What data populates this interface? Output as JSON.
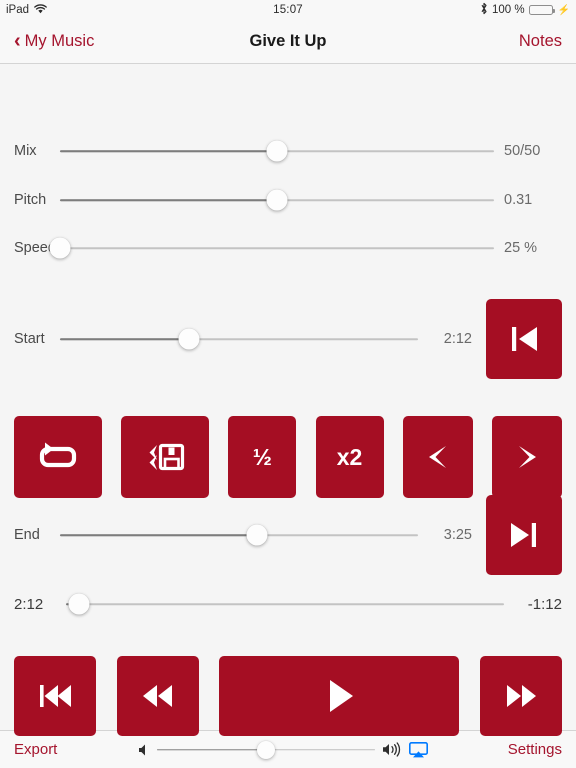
{
  "status_bar": {
    "device": "iPad",
    "wifi_icon": "wifi-icon",
    "time": "15:07",
    "bluetooth_icon": "bluetooth-icon",
    "battery_percent": "100 %",
    "battery_level": 100,
    "charging_icon": "lightning-bolt-icon"
  },
  "nav_bar": {
    "back_label": "My Music",
    "back_icon": "chevron-left-icon",
    "title": "Give It Up",
    "right_label": "Notes"
  },
  "sliders": {
    "mix": {
      "label": "Mix",
      "value": "50/50",
      "percent": 50
    },
    "pitch": {
      "label": "Pitch",
      "value": "0.31",
      "percent": 50
    },
    "speed": {
      "label": "Speed",
      "value": "25 %",
      "percent": 0
    },
    "start": {
      "label": "Start",
      "value": "2:12",
      "percent": 36
    },
    "end": {
      "label": "End",
      "value": "3:25",
      "percent": 55
    }
  },
  "jump_buttons": {
    "to_start": {
      "name": "skip-to-start-button",
      "icon": "skip-to-start-icon"
    },
    "to_end": {
      "name": "skip-to-end-button",
      "icon": "skip-to-end-icon"
    }
  },
  "loop_controls": [
    {
      "name": "loop-button",
      "icon": "loop-repeat-icon",
      "text": ""
    },
    {
      "name": "save-loop-button",
      "icon": "save-loop-icon",
      "text": ""
    },
    {
      "name": "half-speed-button",
      "icon": "",
      "text": "½"
    },
    {
      "name": "double-speed-button",
      "icon": "",
      "text": "x2"
    },
    {
      "name": "nudge-left-button",
      "icon": "arrow-left-icon",
      "text": ""
    },
    {
      "name": "nudge-right-button",
      "icon": "arrow-right-icon",
      "text": ""
    }
  ],
  "playback": {
    "elapsed": "2:12",
    "remaining": "-1:12",
    "progress_percent": 3
  },
  "transport": {
    "previous": {
      "name": "previous-track-button",
      "icon": "previous-track-icon"
    },
    "rewind": {
      "name": "rewind-button",
      "icon": "rewind-icon"
    },
    "play": {
      "name": "play-button",
      "icon": "play-icon"
    },
    "forward": {
      "name": "fast-forward-button",
      "icon": "fast-forward-icon"
    }
  },
  "toolbar": {
    "export_label": "Export",
    "settings_label": "Settings",
    "volume_percent": 50,
    "volume_min_icon": "speaker-low-icon",
    "volume_max_icon": "speaker-high-icon",
    "airplay_icon": "airplay-icon"
  },
  "colors": {
    "accent_red": "#a50e23",
    "link_red": "#a5152e",
    "background": "#f5f5f5",
    "battery_green": "#4cd964",
    "airplay_blue": "#007aff"
  }
}
